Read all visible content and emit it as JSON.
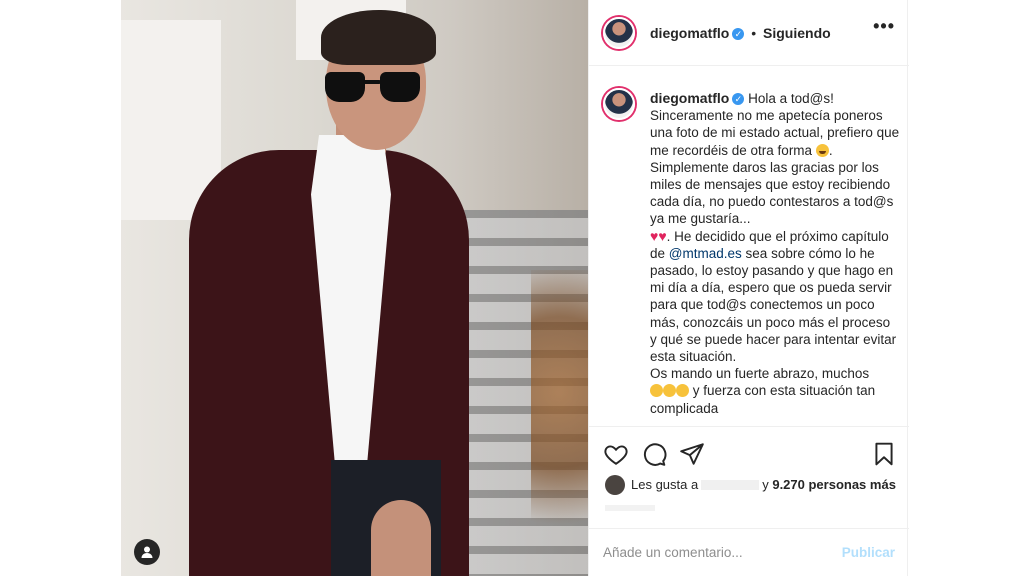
{
  "header": {
    "username": "diegomatflo",
    "follow_status": "Siguiendo",
    "separator": "•",
    "more": "•••"
  },
  "caption": {
    "username": "diegomatflo",
    "text_1": "Hola a tod@s!",
    "text_2": "Sinceramente no me apetecía poneros una foto de mi estado actual, prefiero que me recordéis de otra forma",
    "text_3": ". Simplemente daros las gracias por los miles de mensajes que estoy recibiendo cada día, no puedo contestaros a tod@s ya me gustaría...",
    "text_4": ". He decidido que el próximo capítulo de",
    "mention": "@mtmad.es",
    "text_5": "sea sobre cómo lo he pasado, lo estoy pasando y que hago en mi día a día, espero que os pueda servir para que tod@s conectemos un poco más, conozcáis un poco más el proceso y qué se puede hacer para intentar evitar esta situación.",
    "text_6": "Os mando un fuerte abrazo, muchos",
    "text_7": "y fuerza con esta situación tan complicada"
  },
  "likes": {
    "prefix": "Les gusta a",
    "suffix": "y",
    "count_text": "9.270 personas más"
  },
  "comment": {
    "placeholder": "Añade un comentario...",
    "post_label": "Publicar"
  },
  "colors": {
    "verified": "#3897f0",
    "mention": "#00376b",
    "publish_disabled": "#b2dffc",
    "heart": "#e0245e"
  },
  "icons": [
    "more-icon",
    "heart-icon",
    "comment-icon",
    "share-icon",
    "bookmark-icon",
    "user-tag-icon",
    "verified-icon"
  ]
}
